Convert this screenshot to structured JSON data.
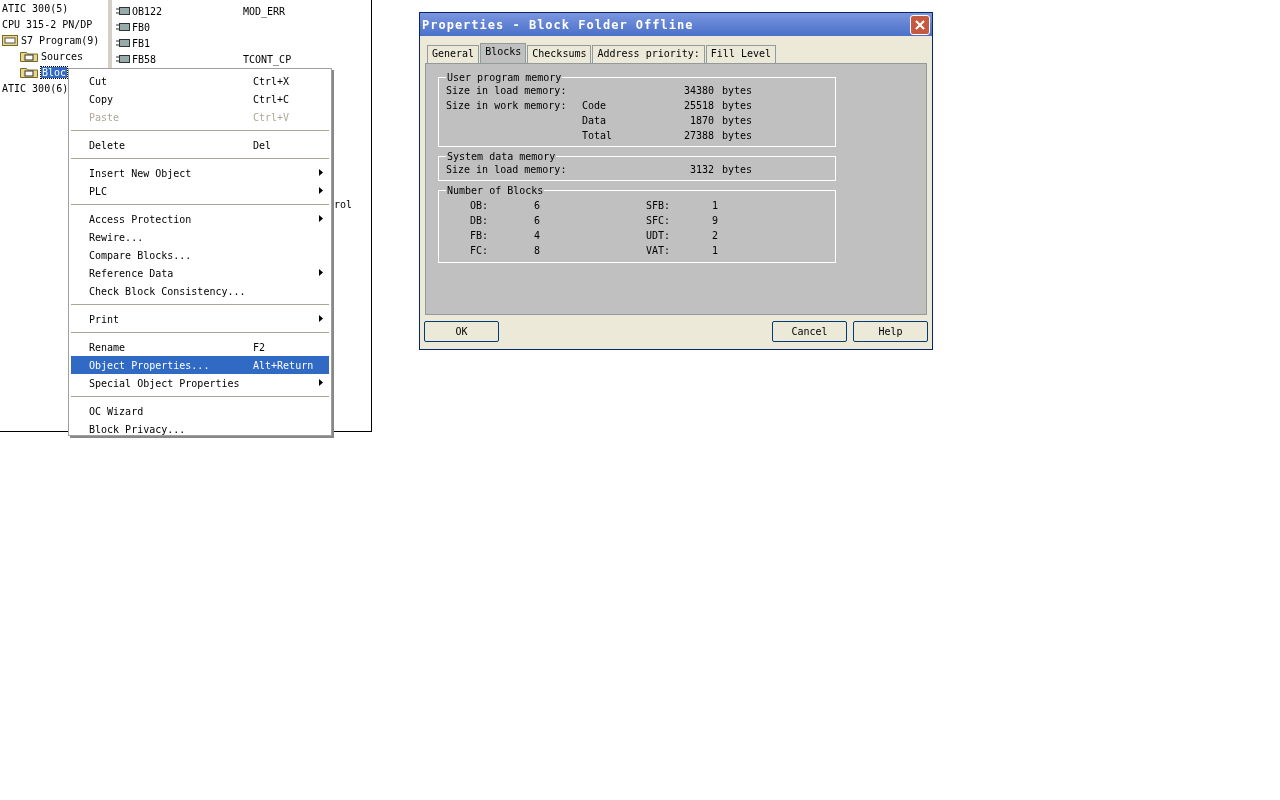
{
  "tree": [
    {
      "label": "ATIC 300(5)",
      "children": [
        {
          "label": "CPU 315-2 PN/DP",
          "children": [
            {
              "label": "S7 Program(9)",
              "kind": "program",
              "children": [
                {
                  "label": "Sources",
                  "kind": "folder",
                  "selected": false
                },
                {
                  "label": "Bloc",
                  "kind": "folder",
                  "selected": true
                }
              ]
            }
          ]
        }
      ]
    },
    {
      "label": "ATIC 300(6)"
    }
  ],
  "block_list": [
    {
      "kind": "row",
      "name": "OB122",
      "comment": "MOD_ERR"
    },
    {
      "kind": "row",
      "name": "FB0"
    },
    {
      "kind": "row",
      "name": "FB1"
    },
    {
      "kind": "row",
      "name": "FB58",
      "comment": "TCONT_CP"
    },
    {
      "kind": "tail",
      "comment": "rol"
    }
  ],
  "context_menu": [
    {
      "kind": "item",
      "label": "Cut",
      "shortcut": "Ctrl+X",
      "disabled": false,
      "submenu": false,
      "selected": false
    },
    {
      "kind": "item",
      "label": "Copy",
      "shortcut": "Ctrl+C",
      "disabled": false,
      "submenu": false,
      "selected": false
    },
    {
      "kind": "item",
      "label": "Paste",
      "shortcut": "Ctrl+V",
      "disabled": true,
      "submenu": false,
      "selected": false
    },
    {
      "kind": "separator"
    },
    {
      "kind": "item",
      "label": "Delete",
      "shortcut": "Del",
      "disabled": false,
      "submenu": false,
      "selected": false
    },
    {
      "kind": "separator"
    },
    {
      "kind": "item",
      "label": "Insert New Object",
      "disabled": false,
      "submenu": true,
      "selected": false
    },
    {
      "kind": "item",
      "label": "PLC",
      "disabled": false,
      "submenu": true,
      "selected": false
    },
    {
      "kind": "separator"
    },
    {
      "kind": "item",
      "label": "Access Protection",
      "disabled": false,
      "submenu": true,
      "selected": false
    },
    {
      "kind": "item",
      "label": "Rewire...",
      "disabled": false,
      "submenu": false,
      "selected": false
    },
    {
      "kind": "item",
      "label": "Compare Blocks...",
      "disabled": false,
      "submenu": false,
      "selected": false
    },
    {
      "kind": "item",
      "label": "Reference Data",
      "disabled": false,
      "submenu": true,
      "selected": false
    },
    {
      "kind": "item",
      "label": "Check Block Consistency...",
      "disabled": false,
      "submenu": false,
      "selected": false
    },
    {
      "kind": "separator"
    },
    {
      "kind": "item",
      "label": "Print",
      "disabled": false,
      "submenu": true,
      "selected": false
    },
    {
      "kind": "separator"
    },
    {
      "kind": "item",
      "label": "Rename",
      "shortcut": "F2",
      "disabled": false,
      "submenu": false,
      "selected": false
    },
    {
      "kind": "item",
      "label": "Object Properties...",
      "shortcut": "Alt+Return",
      "disabled": false,
      "submenu": false,
      "selected": true
    },
    {
      "kind": "item",
      "label": "Special Object Properties",
      "disabled": false,
      "submenu": true,
      "selected": false
    },
    {
      "kind": "separator"
    },
    {
      "kind": "item",
      "label": "OC Wizard",
      "disabled": false,
      "submenu": false,
      "selected": false
    },
    {
      "kind": "item",
      "label": "Block Privacy...",
      "disabled": false,
      "submenu": false,
      "selected": false
    }
  ],
  "dialog": {
    "title": "Properties - Block Folder Offline",
    "tabs": [
      {
        "label": "General",
        "selected": false
      },
      {
        "label": "Blocks",
        "selected": true
      },
      {
        "label": "Checksums",
        "selected": false
      },
      {
        "label": "Address priority:",
        "selected": false
      },
      {
        "label": "Fill Level",
        "selected": false
      }
    ],
    "groups": [
      {
        "kind": "memory",
        "title": "User program memory",
        "rows": [
          {
            "label": "Size in load memory:",
            "value": "34380",
            "unit": "bytes"
          },
          {
            "label": "Size in work memory:",
            "sublabel": "Code",
            "value": "25518",
            "unit": "bytes"
          },
          {
            "sublabel": "Data",
            "value": "1870",
            "unit": "bytes"
          },
          {
            "sublabel": "Total",
            "value": "27388",
            "unit": "bytes"
          }
        ]
      },
      {
        "kind": "memory",
        "title": "System data memory",
        "rows": [
          {
            "label": "Size in load memory:",
            "value": "3132",
            "unit": "bytes"
          }
        ]
      },
      {
        "kind": "counts",
        "title": "Number of Blocks",
        "counts": [
          {
            "label": "OB:",
            "value": "6"
          },
          {
            "label": "SFB:",
            "value": "1"
          },
          {
            "label": "DB:",
            "value": "6"
          },
          {
            "label": "SFC:",
            "value": "9"
          },
          {
            "label": "FB:",
            "value": "4"
          },
          {
            "label": "UDT:",
            "value": "2"
          },
          {
            "label": "FC:",
            "value": "8"
          },
          {
            "label": "VAT:",
            "value": "1"
          }
        ]
      }
    ],
    "buttons": [
      {
        "label": "OK",
        "kind": "left"
      },
      {
        "label": "Cancel",
        "kind": "right"
      },
      {
        "label": "Help",
        "kind": "right"
      }
    ]
  }
}
